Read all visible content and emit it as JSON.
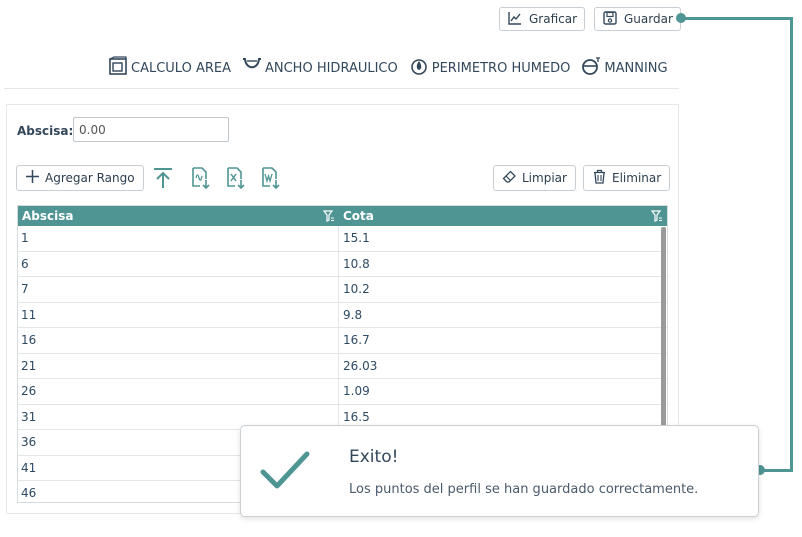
{
  "header": {
    "graficar_label": "Graficar",
    "guardar_label": "Guardar"
  },
  "nav": {
    "items": [
      {
        "label": "CALCULO AREA",
        "icon": "area-icon"
      },
      {
        "label": "ANCHO HIDRAULICO",
        "icon": "channel-icon"
      },
      {
        "label": "PERIMETRO HUMEDO",
        "icon": "water-drop-icon"
      },
      {
        "label": "MANNING",
        "icon": "manning-icon"
      }
    ]
  },
  "form": {
    "abscisa_label": "Abscisa:",
    "abscisa_value": "0.00"
  },
  "toolbar": {
    "agregar_rango_label": "Agregar Rango",
    "limpiar_label": "Limpiar",
    "eliminar_label": "Eliminar"
  },
  "table": {
    "columns": [
      "Abscisa",
      "Cota"
    ],
    "rows": [
      [
        "1",
        "15.1"
      ],
      [
        "6",
        "10.8"
      ],
      [
        "7",
        "10.2"
      ],
      [
        "11",
        "9.8"
      ],
      [
        "16",
        "16.7"
      ],
      [
        "21",
        "26.03"
      ],
      [
        "26",
        "1.09"
      ],
      [
        "31",
        "16.5"
      ],
      [
        "36",
        ""
      ],
      [
        "41",
        ""
      ],
      [
        "46",
        ""
      ]
    ]
  },
  "toast": {
    "title": "Exito!",
    "message": "Los puntos del perfil se han guardado correctamente."
  },
  "colors": {
    "accent": "#4f9594",
    "text": "#2e3e4e"
  }
}
